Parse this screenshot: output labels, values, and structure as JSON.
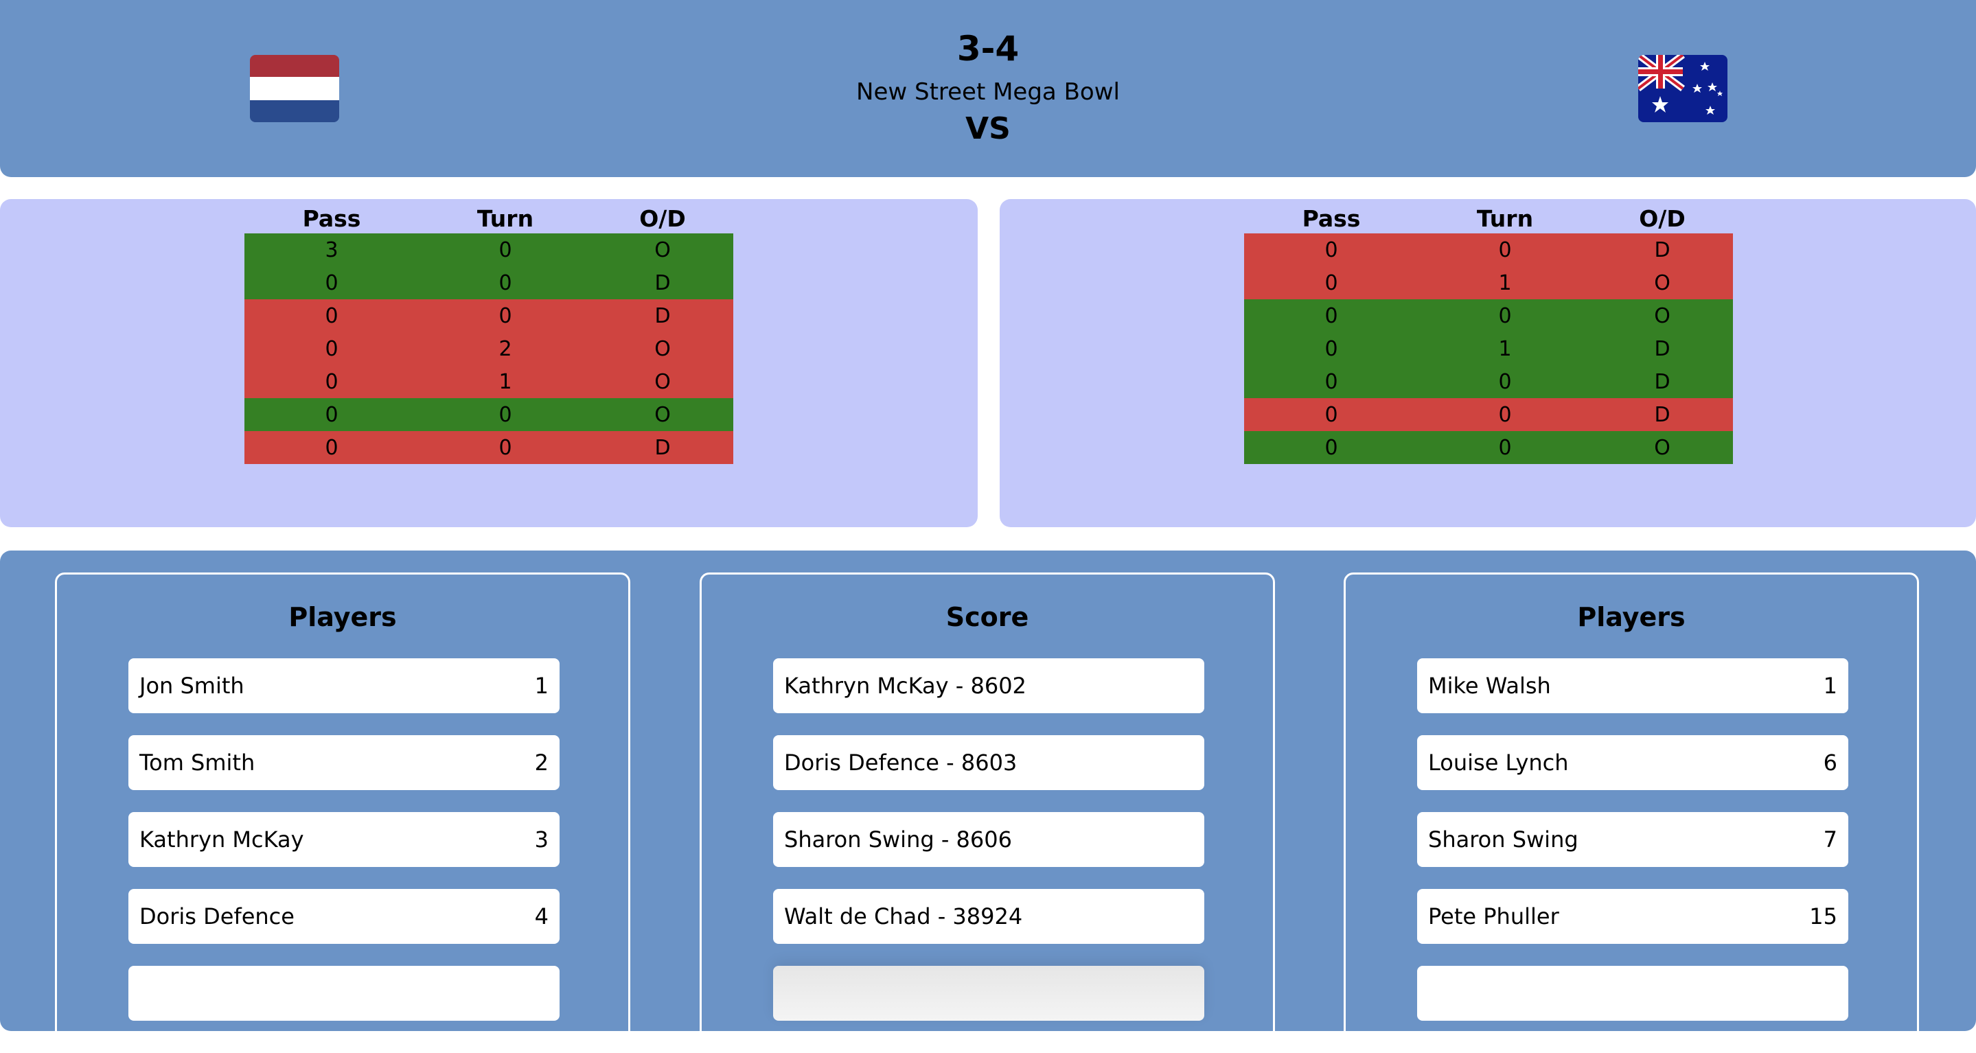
{
  "match": {
    "score": "3-4",
    "venue": "New Street Mega Bowl",
    "vs_label": "VS",
    "home_flag": "netherlands-flag",
    "away_flag": "australia-flag"
  },
  "stats_headers": [
    "Pass",
    "Turn",
    "O/D"
  ],
  "home_stats": [
    {
      "pass": "3",
      "turn": "0",
      "od": "O",
      "status": "green"
    },
    {
      "pass": "0",
      "turn": "0",
      "od": "D",
      "status": "green"
    },
    {
      "pass": "0",
      "turn": "0",
      "od": "D",
      "status": "red"
    },
    {
      "pass": "0",
      "turn": "2",
      "od": "O",
      "status": "red"
    },
    {
      "pass": "0",
      "turn": "1",
      "od": "O",
      "status": "red"
    },
    {
      "pass": "0",
      "turn": "0",
      "od": "O",
      "status": "green"
    },
    {
      "pass": "0",
      "turn": "0",
      "od": "D",
      "status": "red"
    }
  ],
  "away_stats": [
    {
      "pass": "0",
      "turn": "0",
      "od": "D",
      "status": "red"
    },
    {
      "pass": "0",
      "turn": "1",
      "od": "O",
      "status": "red"
    },
    {
      "pass": "0",
      "turn": "0",
      "od": "O",
      "status": "green"
    },
    {
      "pass": "0",
      "turn": "1",
      "od": "D",
      "status": "green"
    },
    {
      "pass": "0",
      "turn": "0",
      "od": "D",
      "status": "green"
    },
    {
      "pass": "0",
      "turn": "0",
      "od": "D",
      "status": "red"
    },
    {
      "pass": "0",
      "turn": "0",
      "od": "O",
      "status": "green"
    }
  ],
  "home_players": {
    "title": "Players",
    "items": [
      {
        "name": "Jon Smith",
        "number": "1"
      },
      {
        "name": "Tom Smith",
        "number": "2"
      },
      {
        "name": "Kathryn McKay",
        "number": "3"
      },
      {
        "name": "Doris Defence",
        "number": "4"
      }
    ]
  },
  "scores": {
    "title": "Score",
    "items": [
      "Kathryn McKay - 8602",
      "Doris Defence - 8603",
      "Sharon Swing - 8606",
      "Walt de Chad - 38924"
    ]
  },
  "away_players": {
    "title": "Players",
    "items": [
      {
        "name": "Mike Walsh",
        "number": "1"
      },
      {
        "name": "Louise Lynch",
        "number": "6"
      },
      {
        "name": "Sharon Swing",
        "number": "7"
      },
      {
        "name": "Pete Phuller",
        "number": "15"
      }
    ]
  },
  "colors": {
    "header_bg": "#6b93c6",
    "stats_bg": "#c3c8fa",
    "green": "#358024",
    "red": "#cf4440"
  }
}
